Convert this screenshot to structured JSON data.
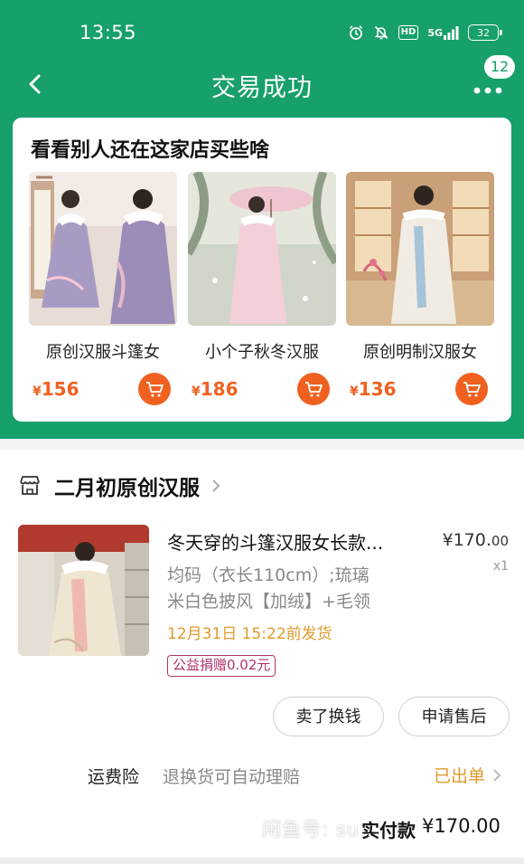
{
  "status_bar": {
    "time": "13:55",
    "hd_label": "HD",
    "signal_label": "5G",
    "battery": "32",
    "icons": [
      "alarm-icon",
      "mute-bell-icon",
      "hd-icon",
      "signal-icon",
      "battery-icon"
    ]
  },
  "nav": {
    "title": "交易成功",
    "badge_count": "12",
    "icons": [
      "back-arrow-icon",
      "more-dots-icon"
    ]
  },
  "recommend": {
    "title": "看看别人还在这家店买些啥",
    "products": [
      {
        "name": "原创汉服斗篷女",
        "currency": "¥",
        "price": "156"
      },
      {
        "name": "小个子秋冬汉服",
        "currency": "¥",
        "price": "186"
      },
      {
        "name": "原创明制汉服女",
        "currency": "¥",
        "price": "136"
      }
    ]
  },
  "order": {
    "shop_name": "二月初原创汉服",
    "item": {
      "title": "冬天穿的斗篷汉服女长款...",
      "price_main": "¥170.",
      "price_cents": "00",
      "quantity": "x1",
      "spec_line1": "均码（衣长110cm）;琉璃",
      "spec_line2": "米白色披风【加绒】+毛领",
      "ship_time": "12月31日 15:22前发货",
      "charity": "公益捐赠0.02元"
    },
    "buttons": {
      "sell": "卖了换钱",
      "after_sale": "申请售后"
    },
    "insurance": {
      "label": "运费险",
      "desc": "退换货可自动理赔",
      "status": "已出单"
    },
    "paid_label": "实付款",
    "paid_amount": "¥170.00",
    "watermark": "闲鱼号: su..."
  },
  "colors": {
    "brand_green": "#17a06a",
    "accent_orange": "#f0611f",
    "ship_orange": "#e09a2b",
    "charity_magenta": "#b0326a"
  }
}
